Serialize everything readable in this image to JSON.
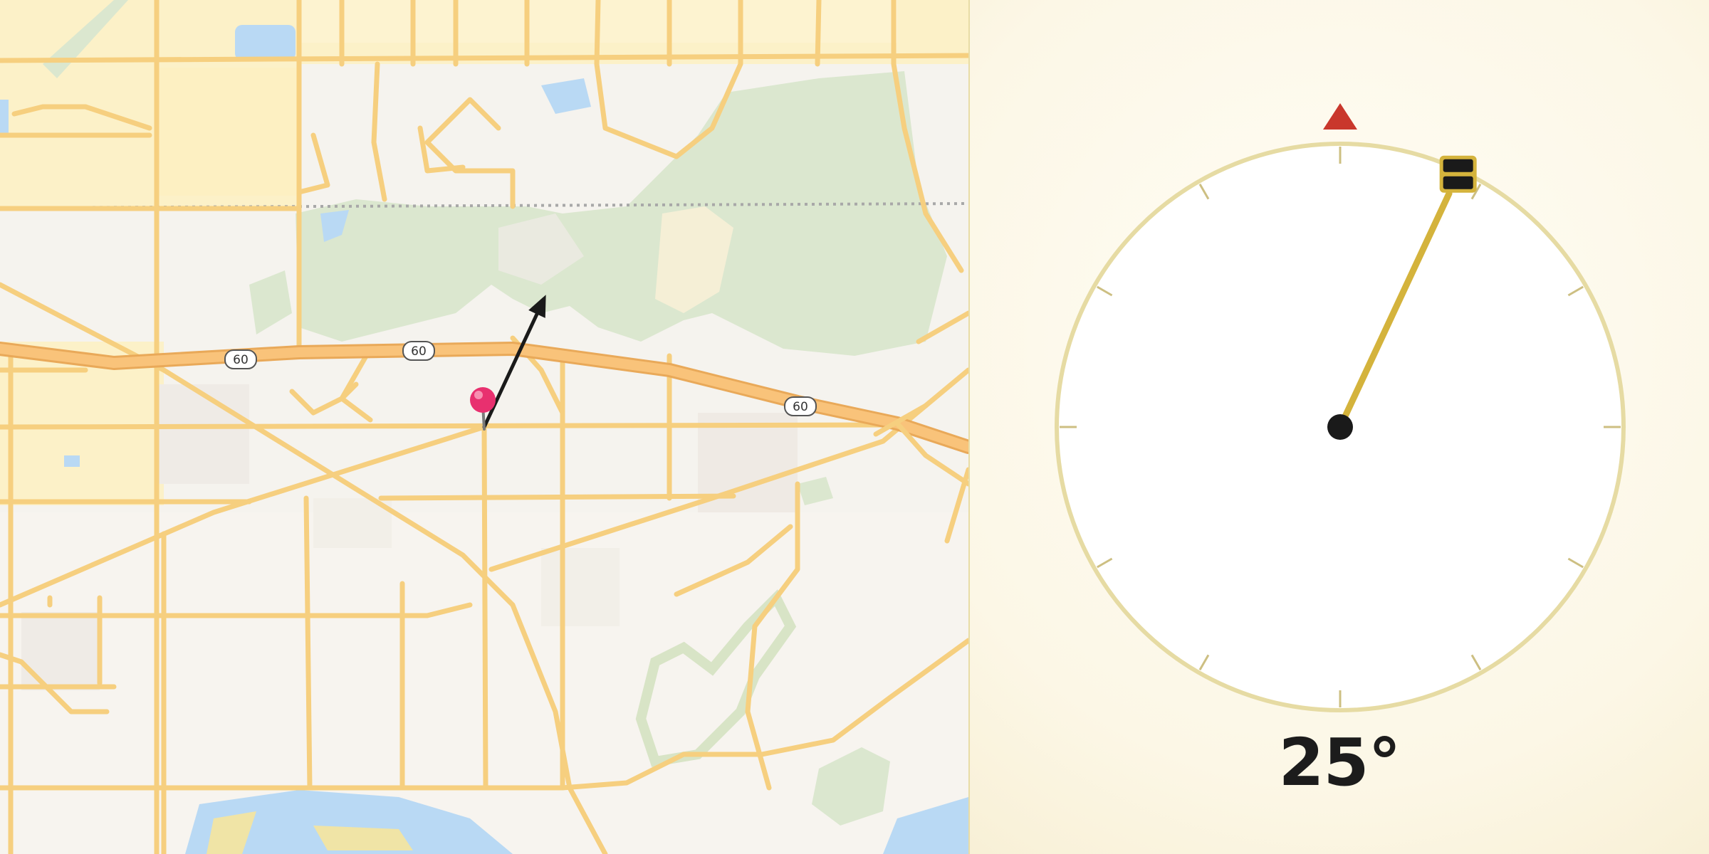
{
  "map": {
    "route_shields": [
      {
        "label": "60"
      },
      {
        "label": "60"
      },
      {
        "label": "60"
      }
    ],
    "pin_color": "#e8306f",
    "arrow_color": "#1a1a1a",
    "colors": {
      "road": "#f6cf7f",
      "highway": "#f4b86a",
      "park": "#dbe7cf",
      "water": "#b9d9f4",
      "residential": "#fcf1c8",
      "background": "#f5f3ee"
    }
  },
  "compass": {
    "heading_deg": 25,
    "heading_label": "25°",
    "north_marker_color": "#c9372c",
    "needle_color": "#d4b33c",
    "ring_color": "#e6dba3",
    "handle_color": "#1a1a1a",
    "tick_count": 12
  }
}
